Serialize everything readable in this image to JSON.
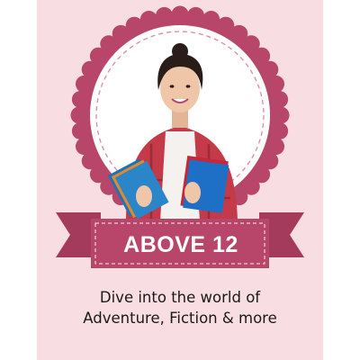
{
  "badge": {
    "age_label": "ABOVE 12",
    "accent_color": "#b8456a",
    "background_color": "#f8dde3"
  },
  "caption": {
    "line1": "Dive into the world of",
    "line2": "Adventure, Fiction & more"
  },
  "photo": {
    "subject": "student-holding-books-photo"
  }
}
